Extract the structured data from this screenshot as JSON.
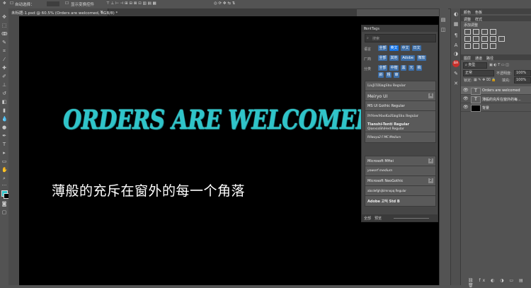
{
  "options_bar": {
    "auto_select_label": "自动选择：",
    "transform_controls_label": "显示变换控件"
  },
  "document_tab": {
    "title": "未标题-1.psd @ 60.5% (Orders are welcomed, RGB/8) *",
    "close": "×"
  },
  "canvas": {
    "title_text": "ORDERS ARE WELCOMED",
    "subtitle_text": "薄般的充斥在窗外的每一个角落",
    "title_color": "#2fc4c9"
  },
  "font_panel": {
    "title": "FontTags",
    "search_placeholder": "搜索",
    "row_labels": [
      "语言",
      "厂商",
      "分类"
    ],
    "language_chips": [
      "全部",
      "英文",
      "中文",
      "日文"
    ],
    "vendor_chips": [
      "全部",
      "其他",
      "Adobe",
      "微软"
    ],
    "category_chips": [
      "全部",
      "中楷",
      "黑",
      "元",
      "稿",
      "斜",
      "粗",
      "审"
    ],
    "fonts": [
      {
        "name": "LiuJiTiXingShu Regular"
      },
      {
        "name": "Meiryo UI",
        "count": "4"
      },
      {
        "name": "MS UI Gothic Regular"
      },
      {
        "name": "PrNewMaoKaiXingShu Regular"
      },
      {
        "name": "Tianshi-Tenti Regular"
      },
      {
        "name": "QianxiaShiHed Regular"
      },
      {
        "name": "Pillwaya2 F-MC Medium"
      },
      {
        "name": "Microsoft MHei",
        "count": "2"
      },
      {
        "name": "yoworf medium"
      },
      {
        "name": "Microsoft NeoGothic",
        "count": "2"
      },
      {
        "name": "abcdefghijklmnopq Regular"
      },
      {
        "name": "Adobe 고딕 Std B"
      }
    ],
    "footer": [
      "全部",
      "预览"
    ]
  },
  "right_panel": {
    "top_tabs": [
      "颜色",
      "色板"
    ],
    "adjust_tabs": [
      "调整",
      "样式"
    ],
    "adjust_title": "添加调整",
    "layers_tabs": [
      "图层",
      "通道",
      "路径"
    ],
    "kind_label": "类型",
    "blend_mode": "正常",
    "opacity_label": "不透明度:",
    "opacity_value": "100%",
    "lock_label": "锁定:",
    "fill_label": "填充:",
    "fill_value": "100%",
    "layers": [
      {
        "name": "Orders are welcomed",
        "type": "T"
      },
      {
        "name": "薄般的充斥在窗外的每...",
        "type": "T"
      },
      {
        "name": "背景",
        "type": ""
      }
    ],
    "badge": "BA"
  }
}
